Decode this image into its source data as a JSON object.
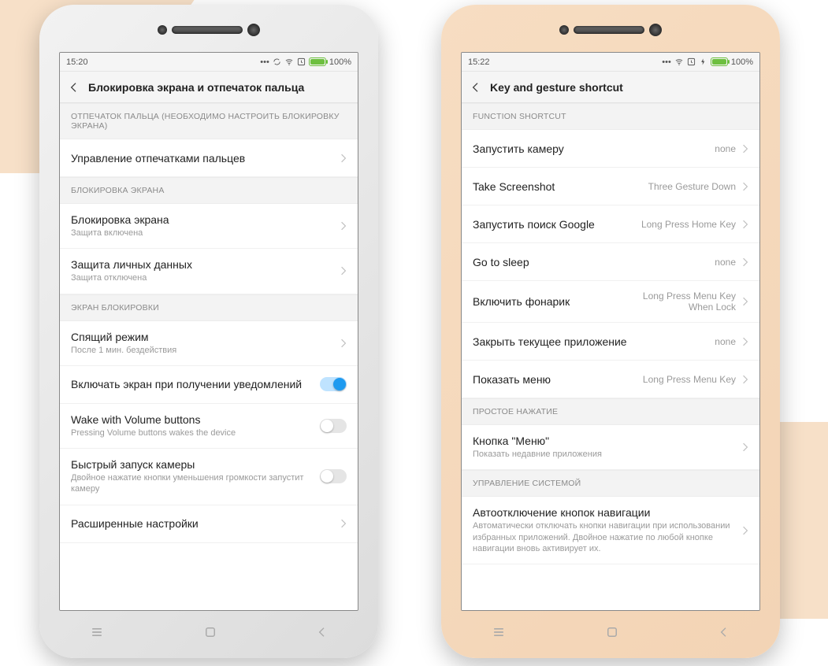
{
  "left": {
    "status": {
      "time": "15:20",
      "battery": "100%"
    },
    "title": "Блокировка экрана и отпечаток пальца",
    "sections": [
      {
        "header": "ОТПЕЧАТОК ПАЛЬЦА (НЕОБХОДИМО НАСТРОИТЬ БЛОКИРОВКУ ЭКРАНА)",
        "rows": [
          {
            "title": "Управление отпечатками пальцев",
            "type": "nav"
          }
        ]
      },
      {
        "header": "БЛОКИРОВКА ЭКРАНА",
        "rows": [
          {
            "title": "Блокировка экрана",
            "sub": "Защита включена",
            "type": "nav"
          },
          {
            "title": "Защита личных данных",
            "sub": "Защита отключена",
            "type": "nav"
          }
        ]
      },
      {
        "header": "ЭКРАН БЛОКИРОВКИ",
        "rows": [
          {
            "title": "Спящий режим",
            "sub": "После 1 мин. бездействия",
            "type": "nav"
          },
          {
            "title": "Включать экран при получении уведомлений",
            "type": "toggle",
            "on": true
          },
          {
            "title": "Wake with Volume buttons",
            "sub": "Pressing Volume buttons wakes the device",
            "type": "toggle",
            "on": false
          },
          {
            "title": "Быстрый запуск камеры",
            "sub": "Двойное нажатие кнопки уменьшения громкости запустит камеру",
            "type": "toggle",
            "on": false
          },
          {
            "title": "Расширенные настройки",
            "type": "nav"
          }
        ]
      }
    ]
  },
  "right": {
    "status": {
      "time": "15:22",
      "battery": "100%"
    },
    "title": "Key and gesture shortcut",
    "sections": [
      {
        "header": "FUNCTION SHORTCUT",
        "rows": [
          {
            "title": "Запустить камеру",
            "value": "none",
            "type": "nav"
          },
          {
            "title": "Take Screenshot",
            "value": "Three Gesture Down",
            "type": "nav"
          },
          {
            "title": "Запустить поиск Google",
            "value": "Long Press Home Key",
            "type": "nav"
          },
          {
            "title": "Go to sleep",
            "value": "none",
            "type": "nav"
          },
          {
            "title": "Включить фонарик",
            "value": "Long Press Menu Key When Lock",
            "type": "nav"
          },
          {
            "title": "Закрыть текущее приложение",
            "value": "none",
            "type": "nav"
          },
          {
            "title": "Показать меню",
            "value": "Long Press Menu Key",
            "type": "nav"
          }
        ]
      },
      {
        "header": "ПРОСТОЕ НАЖАТИЕ",
        "rows": [
          {
            "title": "Кнопка \"Меню\"",
            "sub": "Показать недавние приложения",
            "type": "nav"
          }
        ]
      },
      {
        "header": "УПРАВЛЕНИЕ СИСТЕМОЙ",
        "rows": [
          {
            "title": "Автоотключение кнопок навигации",
            "sub": "Автоматически отключать кнопки навигации при использовании избранных приложений. Двойное нажатие по любой кнопке навигации вновь активирует их.",
            "type": "nav"
          }
        ]
      }
    ]
  }
}
